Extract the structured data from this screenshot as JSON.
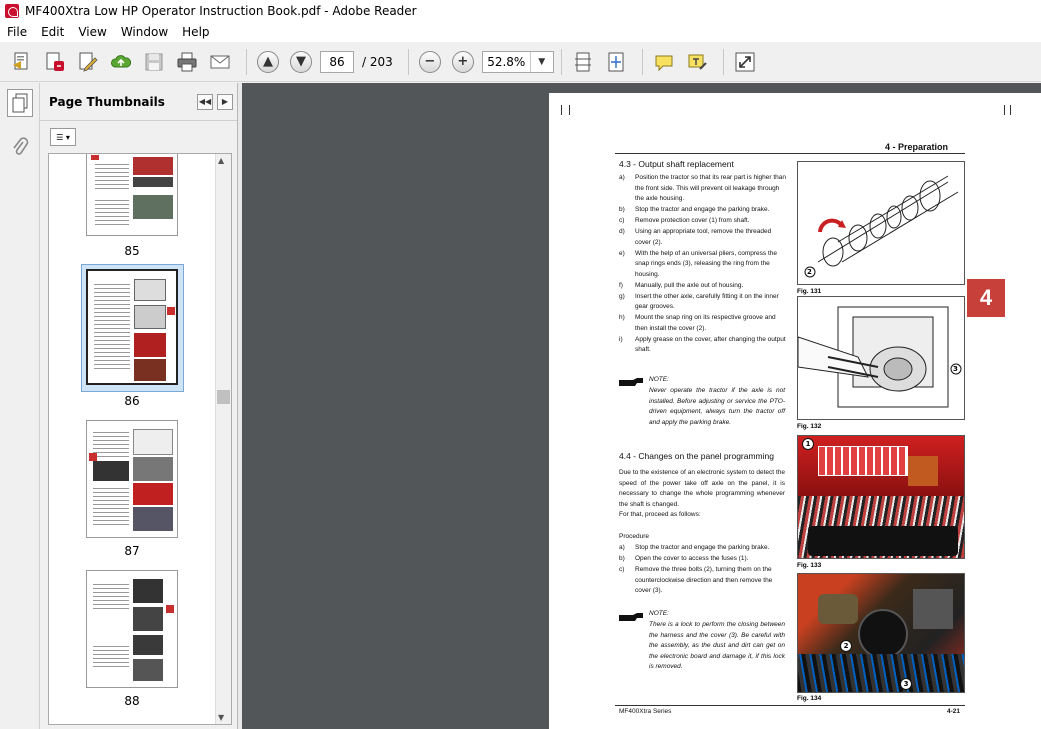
{
  "window": {
    "title": "MF400Xtra Low HP Operator Instruction Book.pdf - Adobe Reader"
  },
  "menu": [
    "File",
    "Edit",
    "View",
    "Window",
    "Help"
  ],
  "toolbar": {
    "page_current": "86",
    "page_total": "/ 203",
    "zoom": "52.8%"
  },
  "panel": {
    "title": "Page Thumbnails"
  },
  "thumbnails": [
    {
      "label": "85"
    },
    {
      "label": "86",
      "selected": true
    },
    {
      "label": "87"
    },
    {
      "label": "88"
    }
  ],
  "document": {
    "section": "4 - Preparation",
    "tab_number": "4",
    "h43": "4.3 - Output shaft replacement",
    "steps43": [
      [
        "a)",
        "Position the tractor so that its rear part is higher than the front side. This will prevent oil leakage through the axle housing."
      ],
      [
        "b)",
        "Stop the tractor and engage the parking brake."
      ],
      [
        "c)",
        "Remove protection cover (1) from shaft."
      ],
      [
        "d)",
        "Using an appropriate tool, remove the threaded cover (2)."
      ],
      [
        "e)",
        "With the help of an universal pliers, compress the snap rings ends (3), releasing the ring from the housing."
      ],
      [
        "f)",
        "Manually, pull the axle out of housing."
      ],
      [
        "g)",
        "Insert the other axle, carefully fitting it on the inner gear grooves."
      ],
      [
        "h)",
        "Mount the snap ring on its respective groove and then install the cover (2)."
      ],
      [
        "i)",
        "Apply grease on the cover, after changing the output shaft."
      ]
    ],
    "note1_label": "NOTE:",
    "note1_text": "Never operate the tractor if the axle is not installed. Before adjusting or service the PTO-driven equipment, always turn the tractor off and apply the parking brake.",
    "h44": "4.4 - Changes on the panel programming",
    "intro44": "Due to the existence of an electronic system to detect the speed of the power take off axle on the panel, it is necessary to change the whole programming whenever the shaft is changed.",
    "proceed": "For that, proceed as follows:",
    "procedure": "Procedure",
    "steps44": [
      [
        "a)",
        "Stop the tractor and engage the parking brake."
      ],
      [
        "b)",
        "Open the cover to access the fuses (1)."
      ],
      [
        "c)",
        "Remove the three bolts (2), turning them on the counterclockwise direction and then remove the cover (3)."
      ]
    ],
    "note2_label": "NOTE:",
    "note2_text": "There is a lock to perform the closing between the harness and the cover (3). Be careful with the assembly, as the dust and dirt can get on the electronic board and damage it, if this lock is removed.",
    "figs": [
      "Fig. 131",
      "Fig. 132",
      "Fig. 133",
      "Fig. 134"
    ],
    "callouts": [
      "2",
      "3",
      "1",
      "2",
      "3"
    ],
    "footer_left": "MF400Xtra Series",
    "footer_right": "4-21"
  }
}
